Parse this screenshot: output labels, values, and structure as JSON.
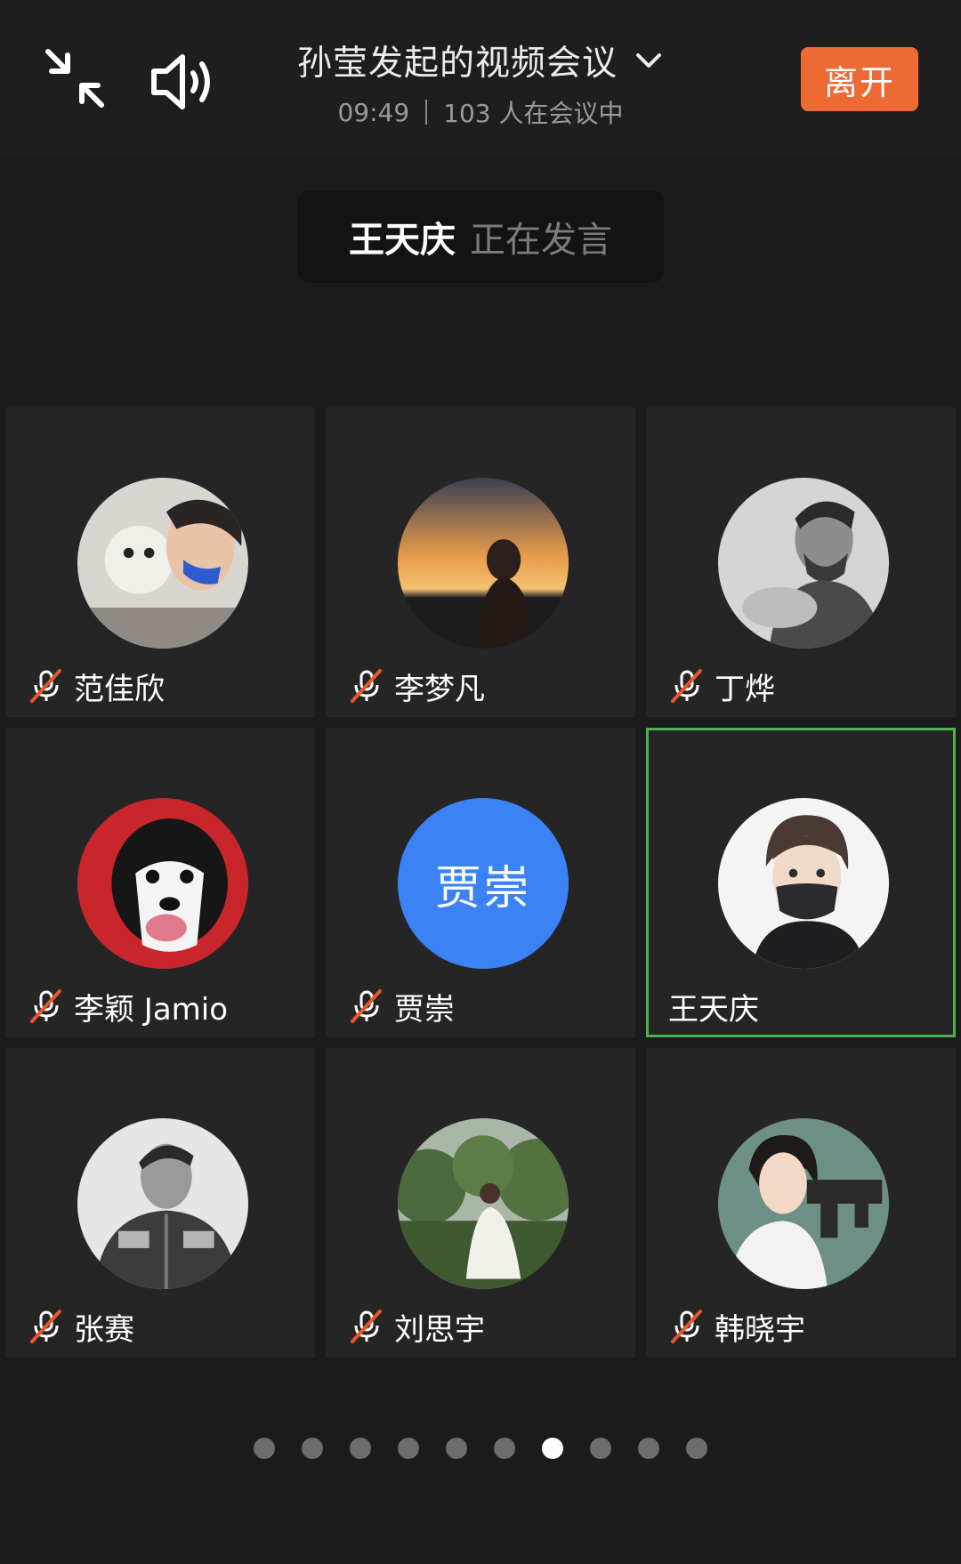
{
  "header": {
    "title": "孙莹发起的视频会议",
    "time": "09:49",
    "participants": "103 人在会议中",
    "leave_label": "离开"
  },
  "speaking": {
    "name": "王天庆",
    "status": "正在发言"
  },
  "tiles": [
    {
      "name": "范佳欣",
      "muted": true,
      "avatar_icon": "avatar-photo"
    },
    {
      "name": "李梦凡",
      "muted": true,
      "avatar_icon": "avatar-photo"
    },
    {
      "name": "丁烨",
      "muted": true,
      "avatar_icon": "avatar-photo"
    },
    {
      "name": "李颖 Jamio",
      "muted": true,
      "avatar_icon": "avatar-photo"
    },
    {
      "name": "贾崇",
      "muted": true,
      "avatar_text": "贾崇",
      "avatar_color": "#3b82f6"
    },
    {
      "name": "王天庆",
      "muted": false,
      "active": true,
      "avatar_icon": "avatar-photo"
    },
    {
      "name": "张赛",
      "muted": true,
      "avatar_icon": "avatar-photo"
    },
    {
      "name": "刘思宇",
      "muted": true,
      "avatar_icon": "avatar-photo"
    },
    {
      "name": "韩晓宇",
      "muted": true,
      "avatar_icon": "avatar-photo"
    }
  ],
  "pagination": {
    "total": 10,
    "current": 7
  },
  "colors": {
    "background": "#1b1b1c",
    "tile": "#252526",
    "leave": "#ed6a35",
    "active_border": "#4caf50",
    "muted_slash": "#e8562a"
  }
}
